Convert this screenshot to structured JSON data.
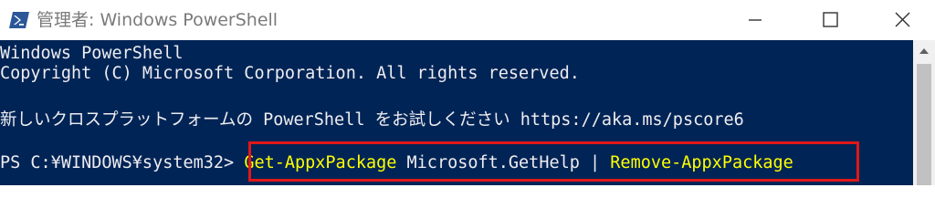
{
  "window": {
    "title": "管理者: Windows PowerShell",
    "icons": {
      "app": "powershell-icon",
      "minimize": "minimize-icon",
      "maximize": "maximize-icon",
      "close": "close-icon"
    }
  },
  "console": {
    "lines": [
      "Windows PowerShell",
      "Copyright (C) Microsoft Corporation. All rights reserved.",
      "新しいクロスプラットフォームの PowerShell をお試しください https://aka.ms/pscore6"
    ],
    "prompt": "PS C:¥WINDOWS¥system32> ",
    "command": {
      "cmdlet1": "Get-AppxPackage",
      "argument": " Microsoft.GetHelp | ",
      "cmdlet2": "Remove-AppxPackage"
    }
  },
  "colors": {
    "console_background": "#012456",
    "console_text": "#eeedf0",
    "cmdlet_text": "#ffff00",
    "highlight_border": "#e01818"
  }
}
